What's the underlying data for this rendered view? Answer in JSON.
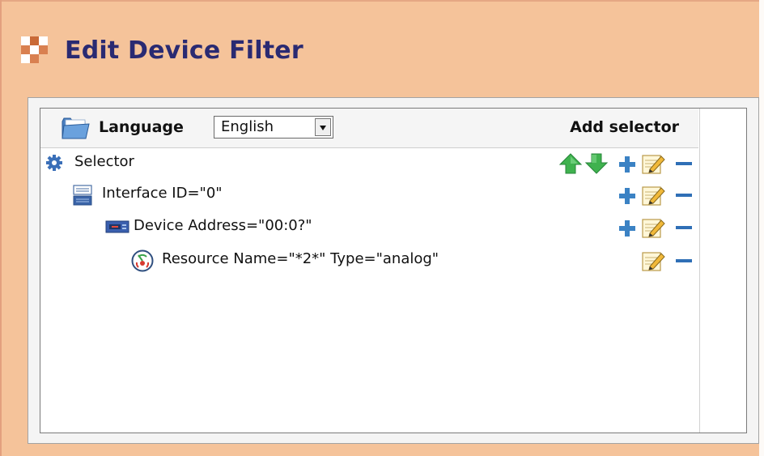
{
  "header": {
    "title": "Edit Device Filter",
    "logo_icon": "app-logo-icon"
  },
  "toolbar": {
    "language_label": "Language",
    "language_select": {
      "value": "English"
    },
    "add_selector_label": "Add selector",
    "folder_icon": "folder-icon"
  },
  "tree": {
    "rows": [
      {
        "label": "Selector",
        "level": 0,
        "icon": "gear-icon",
        "actions": [
          "move-up-icon",
          "move-down-icon",
          "add-icon",
          "edit-icon",
          "remove-icon"
        ]
      },
      {
        "label": "Interface ID=\"0\"",
        "level": 1,
        "icon": "interface-icon",
        "actions": [
          "add-icon",
          "edit-icon",
          "remove-icon"
        ]
      },
      {
        "label": "Device Address=\"00:0?\"",
        "level": 2,
        "icon": "device-icon",
        "actions": [
          "add-icon",
          "edit-icon",
          "remove-icon"
        ]
      },
      {
        "label": "Resource Name=\"*2*\" Type=\"analog\"",
        "level": 3,
        "icon": "resource-icon",
        "actions": [
          "edit-icon",
          "remove-icon"
        ]
      }
    ]
  },
  "colors": {
    "page_background": "#f5c39a",
    "title_color": "#2a2a72",
    "arrow_green": "#39a847",
    "plus_blue": "#3b82c4",
    "minus_blue": "#2f6fb6"
  }
}
